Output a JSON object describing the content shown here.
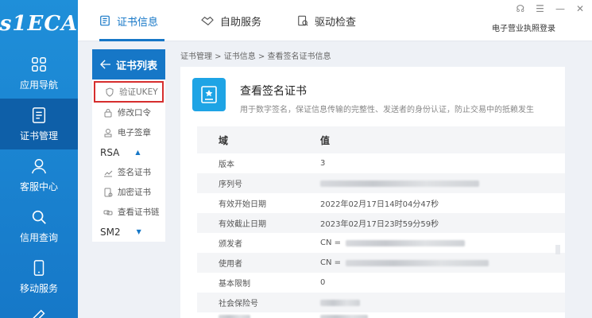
{
  "logo": {
    "text": "s1ECA"
  },
  "left_nav": {
    "items": [
      {
        "label": "应用导航",
        "icon": "grid-icon",
        "active": false
      },
      {
        "label": "证书管理",
        "icon": "document-icon",
        "active": true
      },
      {
        "label": "客服中心",
        "icon": "person-icon",
        "active": false
      },
      {
        "label": "信用查询",
        "icon": "search-icon",
        "active": false
      },
      {
        "label": "移动服务",
        "icon": "mobile-icon",
        "active": false
      }
    ]
  },
  "top_tabs": [
    {
      "label": "证书信息",
      "icon": "certificate-icon",
      "active": true
    },
    {
      "label": "自助服务",
      "icon": "handshake-icon",
      "active": false
    },
    {
      "label": "驱动检查",
      "icon": "driver-check-icon",
      "active": false
    }
  ],
  "header": {
    "license_link": "电子营业执照登录"
  },
  "subnav": {
    "title": "证书列表",
    "items": [
      {
        "label": "验证UKEY",
        "icon": "shield-icon"
      },
      {
        "label": "修改口令",
        "icon": "lock-icon"
      },
      {
        "label": "电子签章",
        "icon": "stamp-icon"
      }
    ],
    "group_rsa": "RSA",
    "rsa_items": [
      {
        "label": "签名证书",
        "icon": "chart-icon"
      },
      {
        "label": "加密证书",
        "icon": "encrypt-doc-icon"
      },
      {
        "label": "查看证书链",
        "icon": "chain-icon"
      }
    ],
    "group_sm2": "SM2"
  },
  "breadcrumb": "证书管理 > 证书信息 > 查看签名证书信息",
  "card": {
    "title": "查看签名证书",
    "subtitle": "用于数字签名，保证信息传输的完整性、发送者的身份认证，防止交易中的抵赖发生"
  },
  "table": {
    "header": {
      "key": "域",
      "value": "值"
    },
    "rows": [
      {
        "key": "版本",
        "value": "3"
      },
      {
        "key": "序列号",
        "value": ""
      },
      {
        "key": "有效开始日期",
        "value": "2022年02月17日14时04分47秒"
      },
      {
        "key": "有效截止日期",
        "value": "2023年02月17日23时59分59秒"
      },
      {
        "key": "颁发者",
        "value": "CN ="
      },
      {
        "key": "使用者",
        "value": "CN ="
      },
      {
        "key": "基本限制",
        "value": "0"
      },
      {
        "key": "社会保险号",
        "value": ""
      }
    ]
  },
  "colors": {
    "nav_blue": "#1f8fd9",
    "nav_active": "#0e5fa8",
    "accent": "#1677c7",
    "highlight_border": "#d62e2e"
  }
}
